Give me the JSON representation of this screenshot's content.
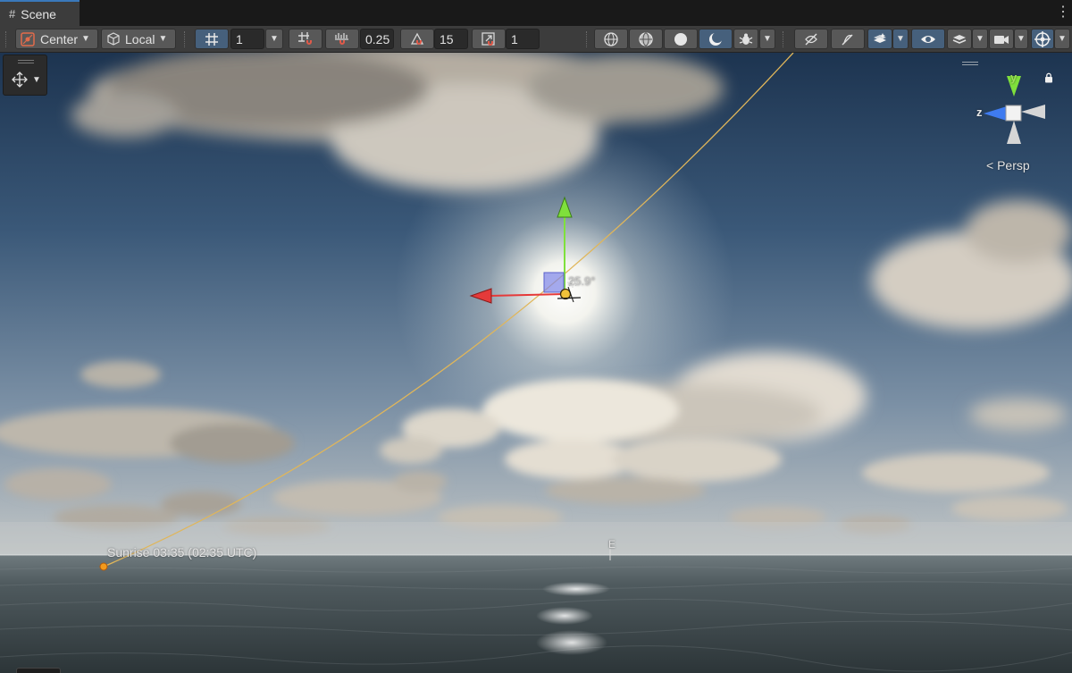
{
  "window": {
    "tab_title": "Scene"
  },
  "toolbar": {
    "pivot_mode": "Center",
    "pivot_rotation": "Local",
    "grid_size": "1",
    "grid_snap_value": "0.25",
    "rotation_snap_value": "15",
    "scale_snap_value": "1"
  },
  "scene": {
    "sunrise_label": "Sunrise 03:35 (02:35 UTC)",
    "sun_angle": "25.9°",
    "compass_east": "E"
  },
  "gizmo": {
    "y_axis": "y",
    "z_axis": "z",
    "projection": "Persp"
  },
  "colors": {
    "active_button": "#46607c",
    "x_axis": "#e53a3a",
    "y_axis": "#7fe03c",
    "z_axis": "#3f7bf0",
    "sun_path": "#e0b65a"
  },
  "icons": {
    "tab": "grid-icon",
    "pivot_mode": "pivot-center-icon",
    "pivot_rotation": "local-cube-icon",
    "grid": "grid-icon",
    "move_tool": "move-tool-icon",
    "lock": "lock-icon"
  }
}
